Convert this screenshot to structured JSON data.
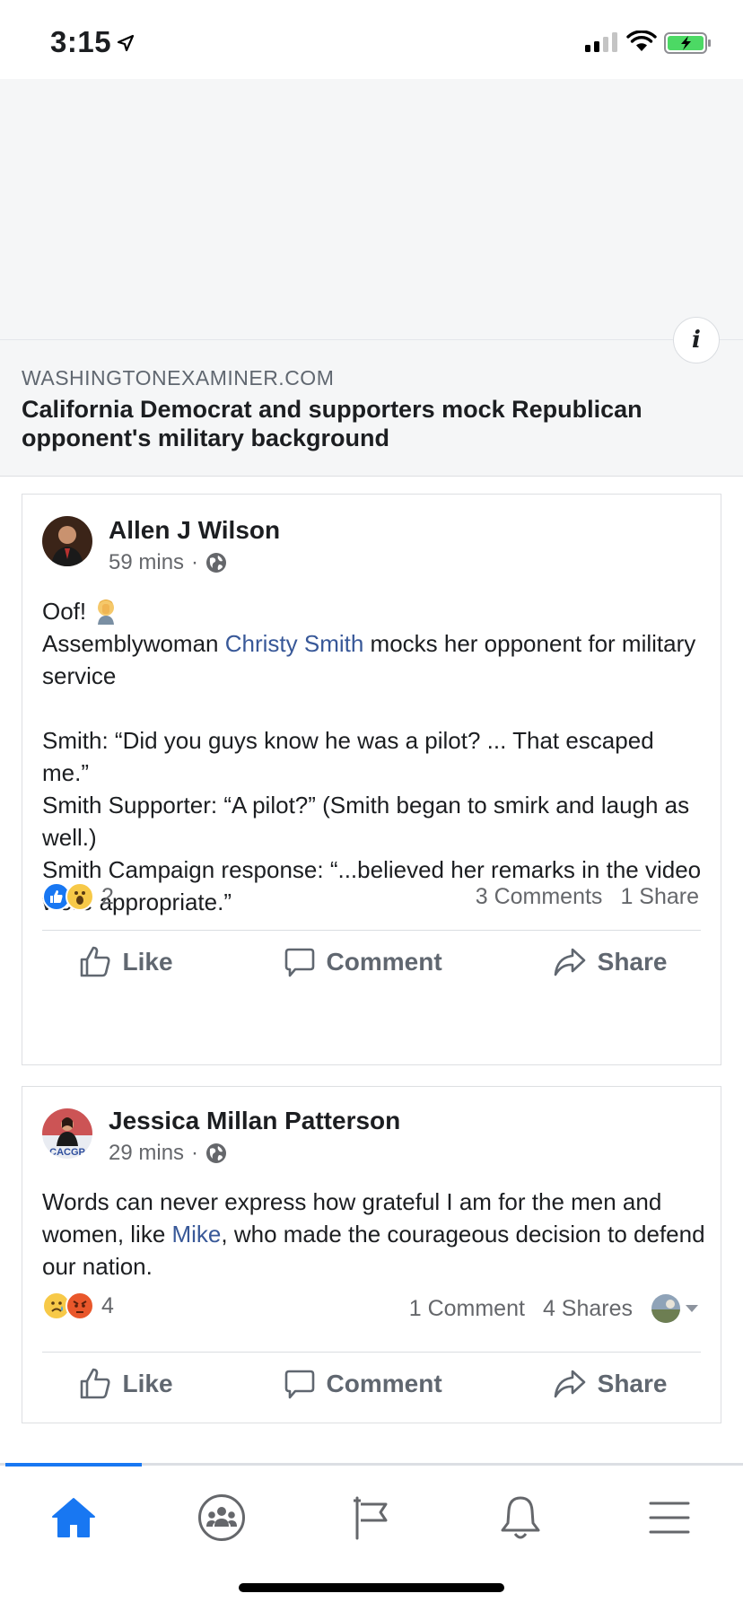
{
  "status_bar": {
    "time": "3:15"
  },
  "link_preview": {
    "domain": "WASHINGTONEXAMINER.COM",
    "headline": "California Democrat and supporters mock Republican opponent's military background"
  },
  "posts": [
    {
      "author": "Allen J Wilson",
      "time": "59 mins",
      "text_line1": "Oof! ",
      "text_pre_mention": "Assemblywoman ",
      "mention": "Christy Smith",
      "text_post_mention": " mocks her opponent for military service",
      "text_body": "Smith:  “Did you guys know he was a pilot? ... That escaped me.”\nSmith Supporter:  “A pilot?” (Smith began to smirk and laugh as well.)\nSmith Campaign response:   “...believed her remarks in the video were appropriate.”",
      "reaction_count": "2",
      "comments": "3 Comments",
      "shares": "1 Share"
    },
    {
      "author": "Jessica Millan Patterson",
      "time": "29 mins",
      "avatar_badge": "CACGP",
      "text_pre_mention": "Words can never express how grateful I am for the men and women, like ",
      "mention": "Mike",
      "text_post_mention": ", who made the courageous decision to defend our nation.",
      "reaction_count": "4",
      "comments": "1 Comment",
      "shares": "4 Shares"
    }
  ],
  "actions": {
    "like": "Like",
    "comment": "Comment",
    "share": "Share"
  },
  "colors": {
    "accent": "#1877f2",
    "mention": "#385898",
    "secondary_text": "#65676b"
  },
  "tabs": [
    "home-icon",
    "groups-icon",
    "pages-flag-icon",
    "notifications-bell-icon",
    "menu-icon"
  ]
}
